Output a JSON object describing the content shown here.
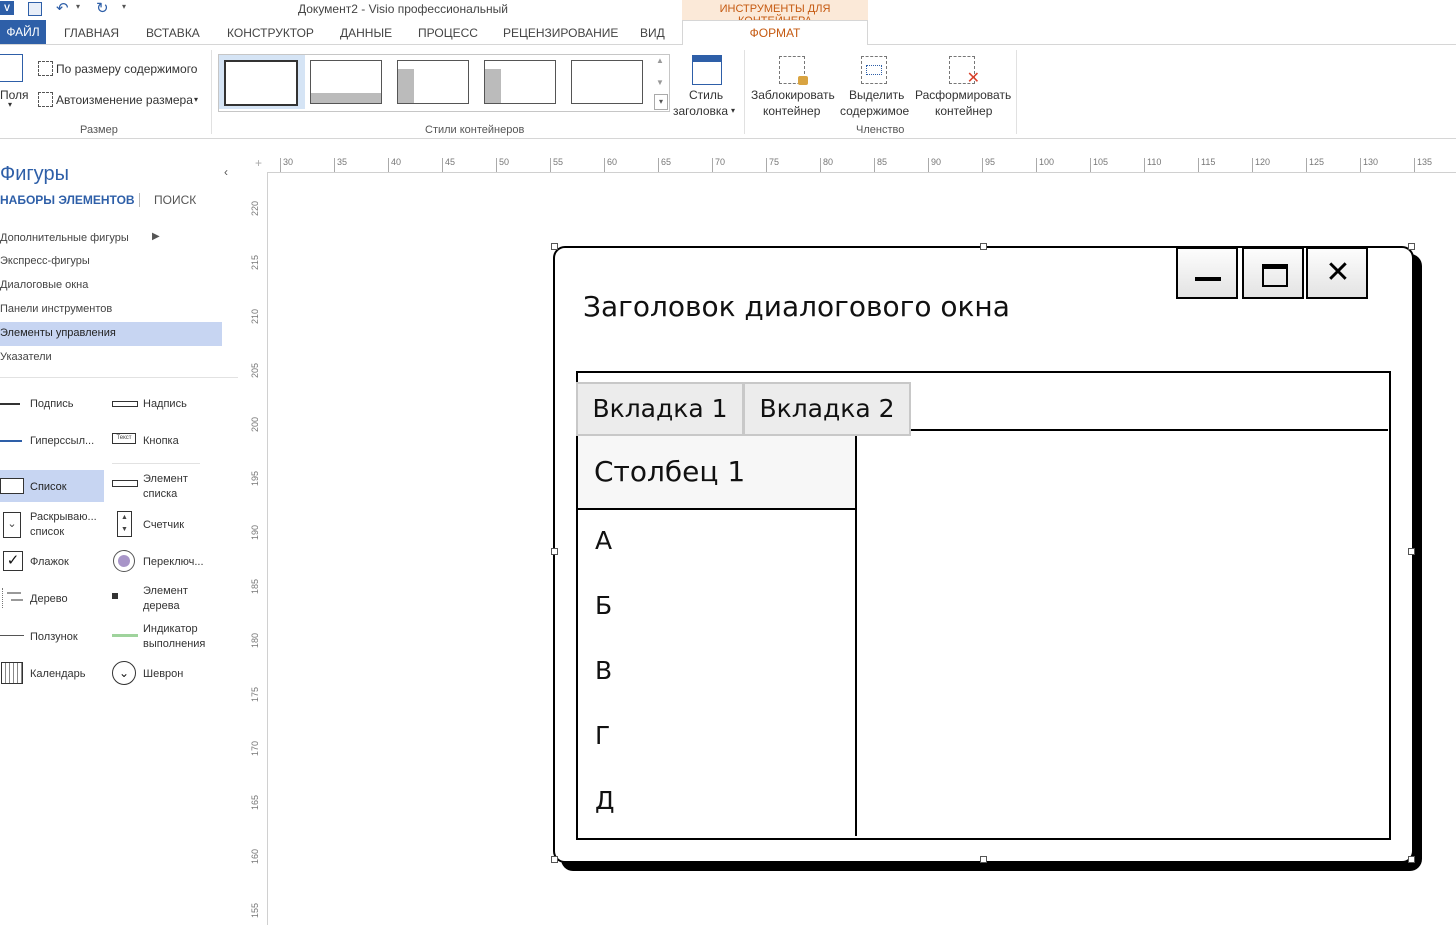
{
  "app": {
    "document_title": "Документ2 -  Visio профессиональный",
    "context_tab_group": "ИНСТРУМЕНТЫ ДЛЯ КОНТЕЙНЕРА"
  },
  "ribbon_tabs": {
    "file": "ФАЙЛ",
    "home": "ГЛАВНАЯ",
    "insert": "ВСТАВКА",
    "design": "КОНСТРУКТОР",
    "data": "ДАННЫЕ",
    "process": "ПРОЦЕСС",
    "review": "РЕЦЕНЗИРОВАНИЕ",
    "view": "ВИД",
    "format": "ФОРМАТ"
  },
  "ribbon": {
    "margins": "Поля",
    "fit_to_contents": "По размеру содержимого",
    "auto_resize": "Автоизменение размера",
    "size_group": "Размер",
    "container_styles_group": "Стили контейнеров",
    "heading_style_line1": "Стиль",
    "heading_style_line2": "заголовка",
    "lock_line1": "Заблокировать",
    "lock_line2": "контейнер",
    "select_line1": "Выделить",
    "select_line2": "содержимое",
    "disband_line1": "Расформировать",
    "disband_line2": "контейнер",
    "membership_group": "Членство"
  },
  "shapes_pane": {
    "title": "Фигуры",
    "stencils_tab": "НАБОРЫ ЭЛЕМЕНТОВ",
    "search_tab": "ПОИСК",
    "stencils": [
      "Дополнительные фигуры",
      "Экспресс-фигуры",
      "Диалоговые окна",
      "Панели инструментов",
      "Элементы управления",
      "Указатели"
    ],
    "shapes": {
      "caption": "Подпись",
      "label": "Надпись",
      "hyperlink": "Гиперссыл...",
      "button": "Кнопка",
      "list": "Список",
      "list_item_1": "Элемент",
      "list_item_2": "списка",
      "dropdown_1": "Раскрываю...",
      "dropdown_2": "список",
      "counter": "Счетчик",
      "checkbox": "Флажок",
      "radio": "Переключ...",
      "tree": "Дерево",
      "tree_item_1": "Элемент",
      "tree_item_2": "дерева",
      "slider": "Ползунок",
      "progress_1": "Индикатор",
      "progress_2": "выполнения",
      "calendar": "Календарь",
      "chevron": "Шеврон"
    }
  },
  "rulers": {
    "h": [
      "30",
      "35",
      "40",
      "45",
      "50",
      "55",
      "60",
      "65",
      "70",
      "75",
      "80",
      "85",
      "90",
      "95",
      "100",
      "105",
      "110",
      "115",
      "120",
      "125",
      "130",
      "135"
    ],
    "v": [
      "220",
      "215",
      "210",
      "205",
      "200",
      "195",
      "190",
      "185",
      "180",
      "175",
      "170",
      "165",
      "160",
      "155"
    ]
  },
  "diagram": {
    "title": "Заголовок диалогового окна",
    "tab1": "Вкладка 1",
    "tab2": "Вкладка 2",
    "column": "Столбец 1",
    "items": [
      "А",
      "Б",
      "В",
      "Г",
      "Д"
    ]
  }
}
